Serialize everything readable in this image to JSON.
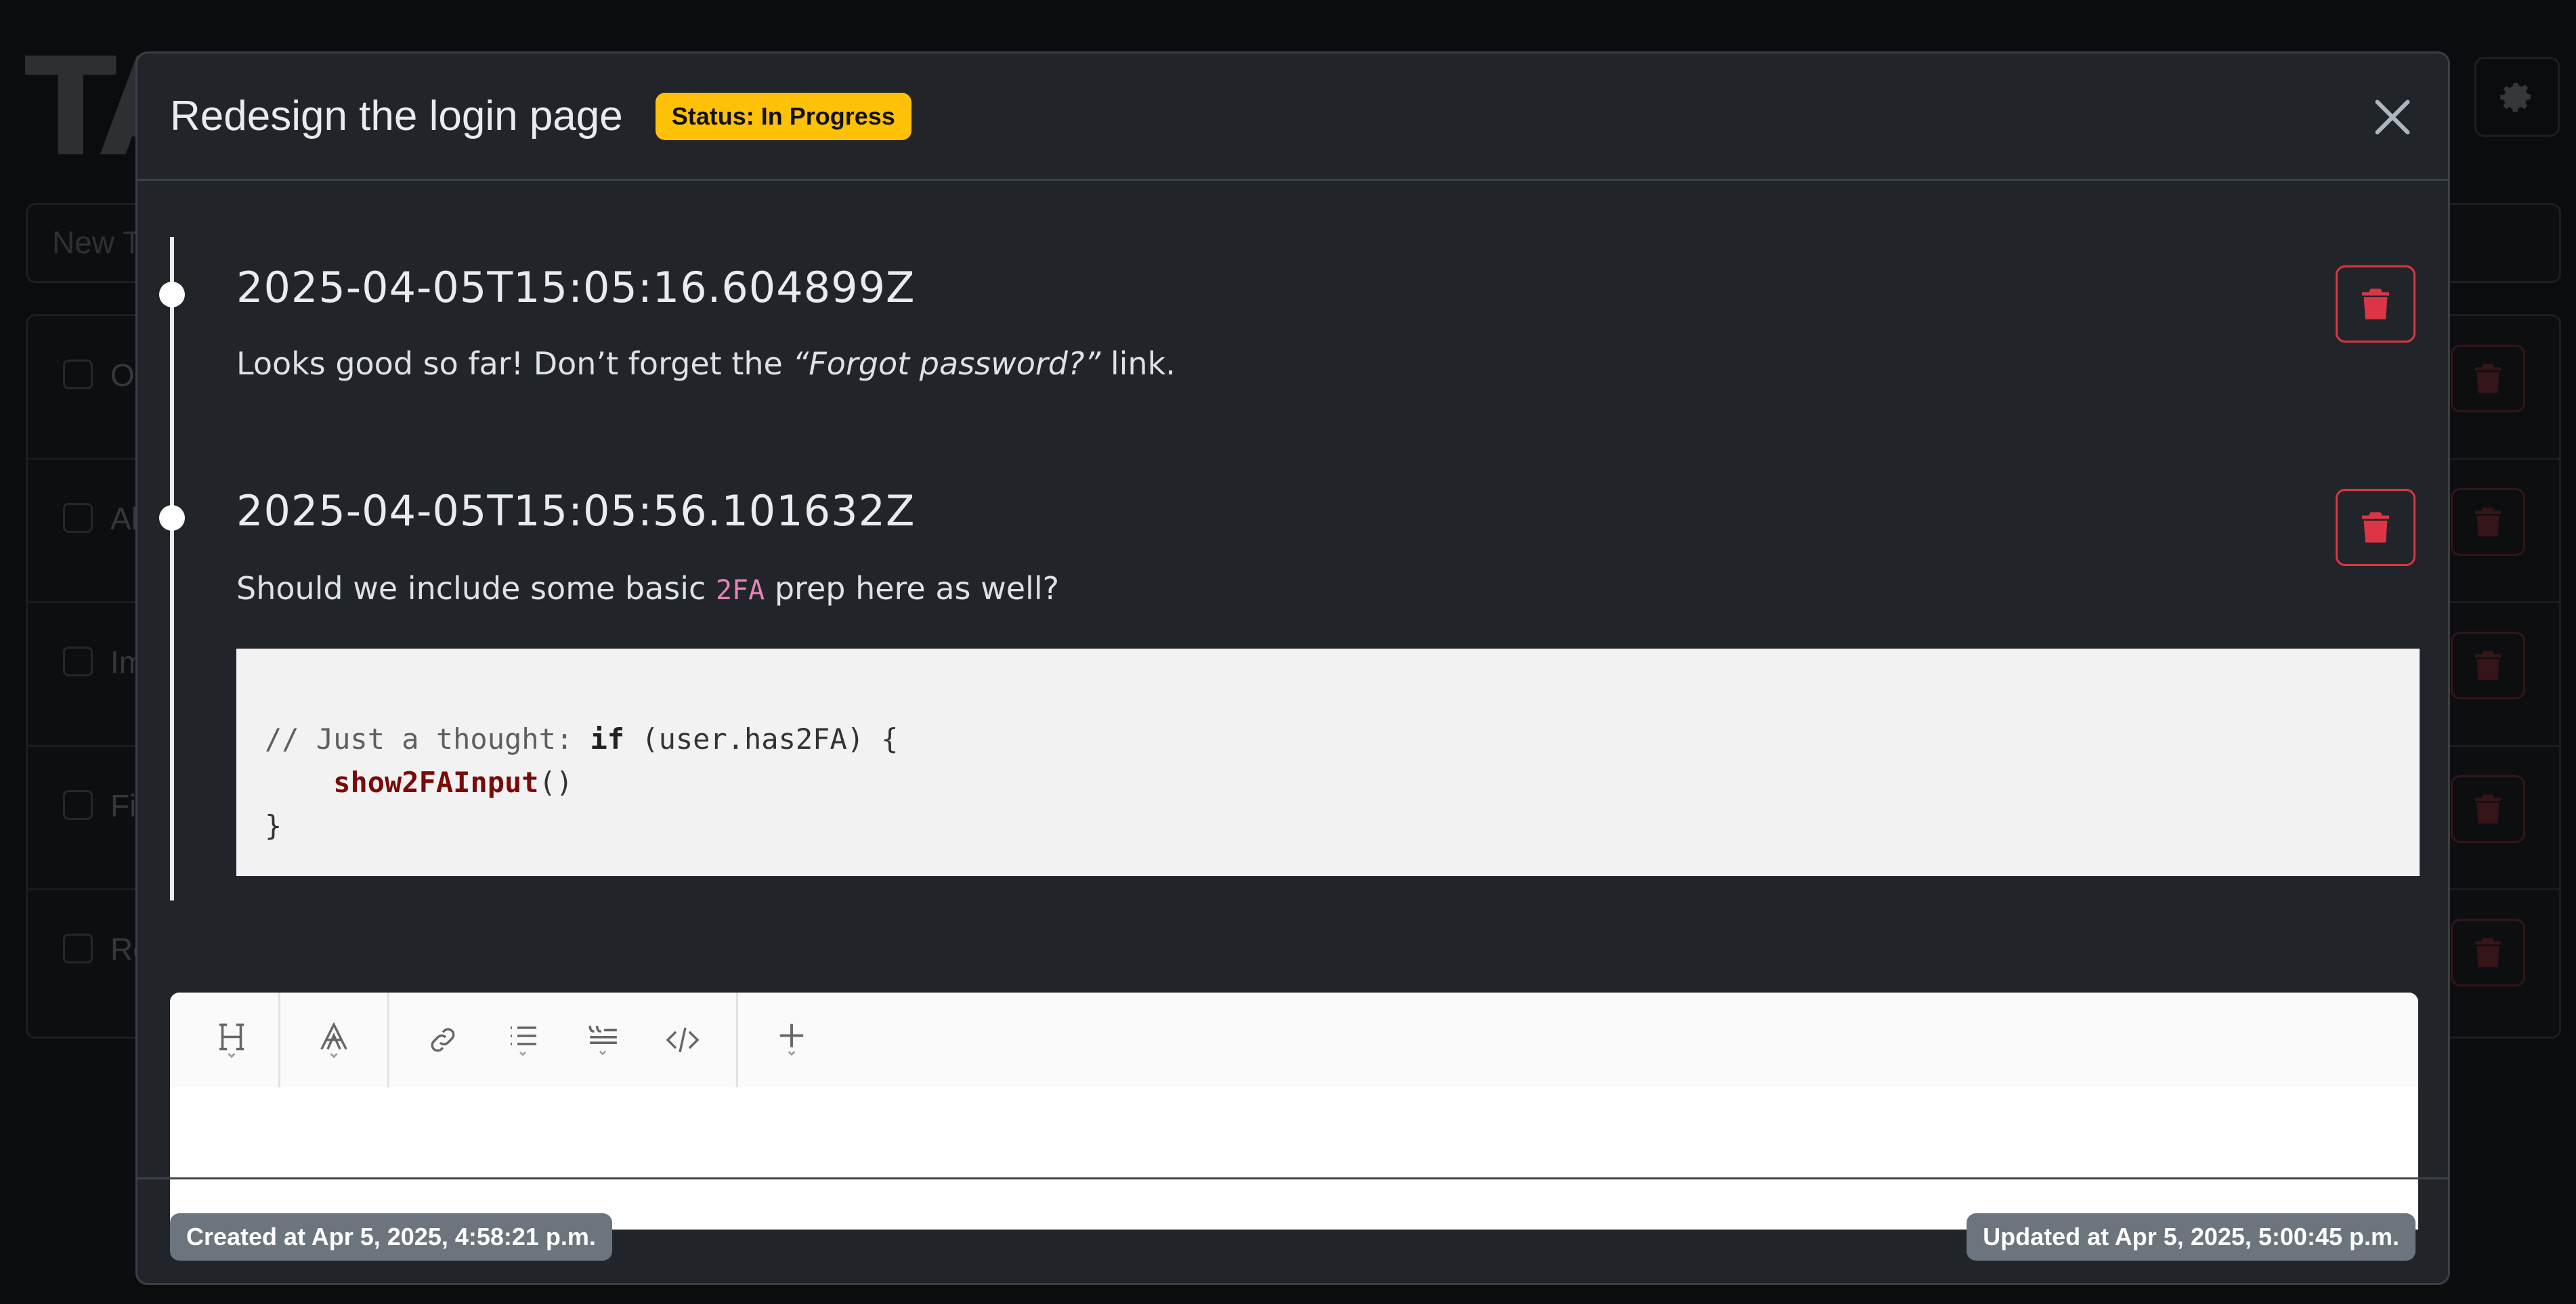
{
  "background": {
    "logo": "TA",
    "new_task_placeholder": "New T",
    "task_rows": [
      "Op",
      "Al",
      "Im",
      "Fi",
      "Re"
    ]
  },
  "modal": {
    "title": "Redesign the login page",
    "status_badge": "Status: In Progress",
    "comments": [
      {
        "timestamp": "2025-04-05T15:05:16.604899Z",
        "text_before": "Looks good so far! Don’t forget the ",
        "text_em": "“Forgot password?”",
        "text_after": " link."
      },
      {
        "timestamp": "2025-04-05T15:05:56.101632Z",
        "text_before": "Should we include some basic ",
        "inline_code": "2FA",
        "text_after": " prep here as well?",
        "code": {
          "comment": "// Just a thought: ",
          "keyword": "if",
          "condition": " (user.has2FA) {",
          "indent": "    ",
          "function": "show2FAInput",
          "call_parens": "()",
          "closing": "}"
        }
      }
    ],
    "editor_toolbar": [
      "heading-icon",
      "text-style-icon",
      "link-icon",
      "list-icon",
      "quote-icon",
      "code-icon",
      "plus-icon"
    ],
    "footer": {
      "created": "Created at Apr 5, 2025, 4:58:21 p.m.",
      "updated": "Updated at Apr 5, 2025, 5:00:45 p.m."
    }
  },
  "colors": {
    "status_badge": "#ffc107",
    "danger": "#dc3545",
    "secondary_badge": "#6c757d",
    "modal_bg": "#212529"
  }
}
